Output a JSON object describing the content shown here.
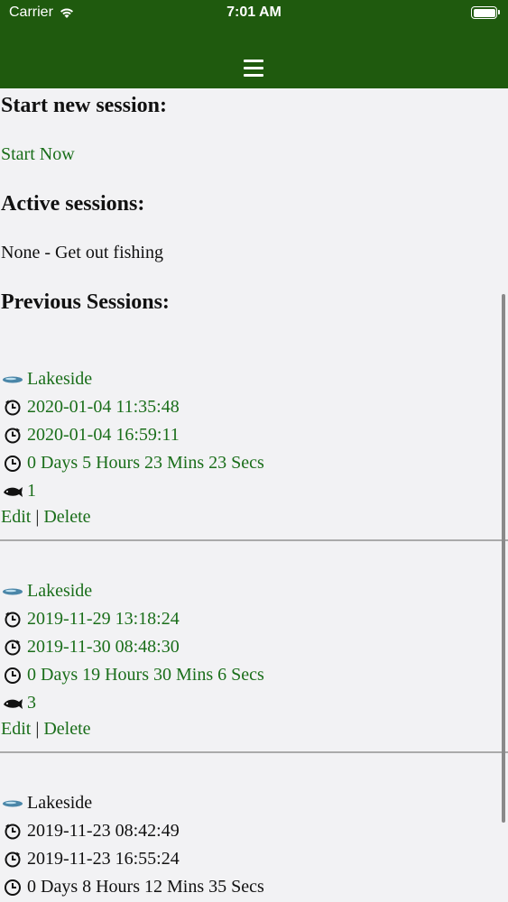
{
  "status_bar": {
    "carrier": "Carrier",
    "time": "7:01 AM"
  },
  "header": {
    "menu_icon": "hamburger-menu-icon"
  },
  "start_section": {
    "title": "Start new session:",
    "link": "Start Now"
  },
  "active_section": {
    "title": "Active sessions:",
    "empty_text": "None - Get out fishing"
  },
  "previous_section": {
    "title": "Previous Sessions:"
  },
  "sessions": [
    {
      "location": "Lakeside",
      "start": "2020-01-04 11:35:48",
      "end": "2020-01-04 16:59:11",
      "duration": "0 Days 5 Hours 23 Mins 23 Secs",
      "catches": "1",
      "edit": "Edit",
      "separator": "|",
      "delete": "Delete"
    },
    {
      "location": "Lakeside",
      "start": "2019-11-29 13:18:24",
      "end": "2019-11-30 08:48:30",
      "duration": "0 Days 19 Hours 30 Mins 6 Secs",
      "catches": "3",
      "edit": "Edit",
      "separator": "|",
      "delete": "Delete"
    },
    {
      "location": "Lakeside",
      "start": "2019-11-23 08:42:49",
      "end": "2019-11-23 16:55:24",
      "duration": "0 Days 8 Hours 12 Mins 35 Secs"
    }
  ],
  "colors": {
    "header_bg": "#1f5a0e",
    "link": "#1a6e1a",
    "background": "#f2f2f4"
  }
}
